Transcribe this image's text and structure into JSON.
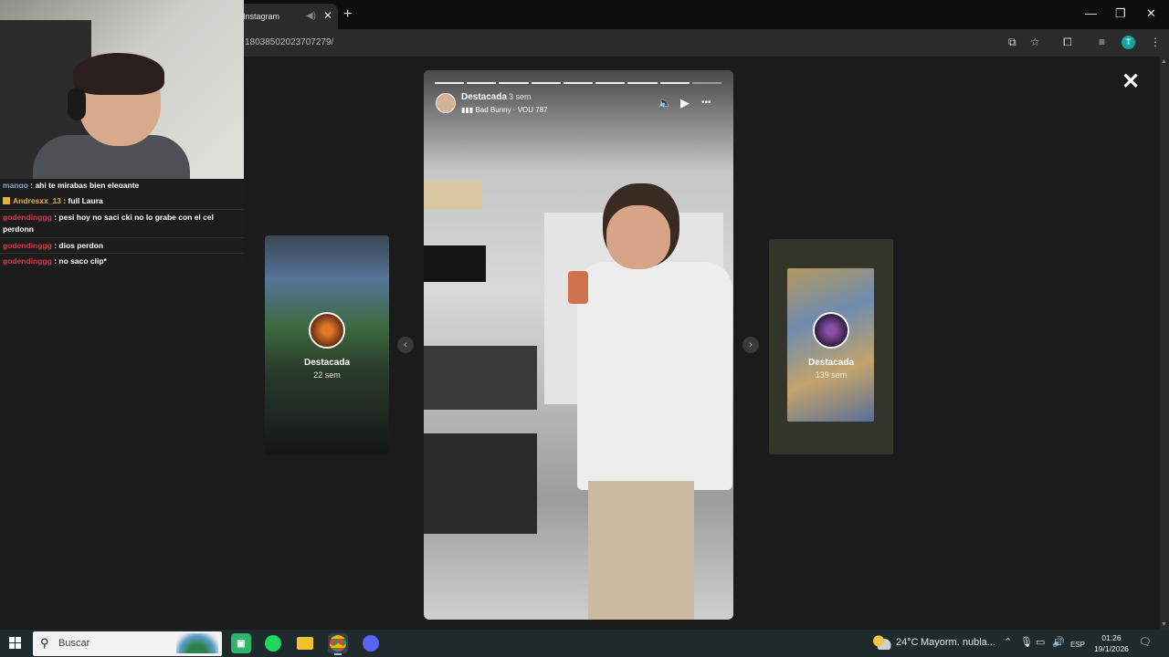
{
  "browser": {
    "tab_title": "Instagram",
    "tab_close": "✕",
    "audio_icon": "speaker-icon",
    "new_tab": "+",
    "url": "18038502023707279/",
    "window_controls": {
      "minimize": "—",
      "restore": "❐",
      "close": "✕"
    }
  },
  "story": {
    "username": "Destacada",
    "time_ago": "3 sem",
    "music": "Bad Bunny · VOU 787",
    "segments": 9,
    "active_segment": 8,
    "controls": {
      "mute": "🔈",
      "play": "▶",
      "more": "•••"
    }
  },
  "side_stories": [
    {
      "title": "Destacada",
      "time": "22 sem"
    },
    {
      "title": "Destacada",
      "time": "139 sem"
    }
  ],
  "viewer": {
    "close": "✕",
    "prev": "‹",
    "next": "›"
  },
  "chat": [
    {
      "user": "mango",
      "text": ": ahi te mirabas bien elegante"
    },
    {
      "user": "Andresxx_13",
      "text": ": full Laura"
    },
    {
      "user": "godendinggg",
      "text": ": pesi hoy no saci cki no lo grabe con el cel perdonn"
    },
    {
      "user": "godendinggg",
      "text": ": dios perdon"
    },
    {
      "user": "godendinggg",
      "text": ": no saco clip*"
    }
  ],
  "taskbar": {
    "search_placeholder": "Buscar",
    "weather_temp": "24°C",
    "weather_text": "Mayorm. nubla...",
    "language": "ESP",
    "time": "01:26",
    "date": "19/1/2026"
  },
  "colors": {
    "chat_name_red": "#d83a4a",
    "chat_name_gold": "#e0b23c",
    "profile_badge": "#13a7a0"
  }
}
